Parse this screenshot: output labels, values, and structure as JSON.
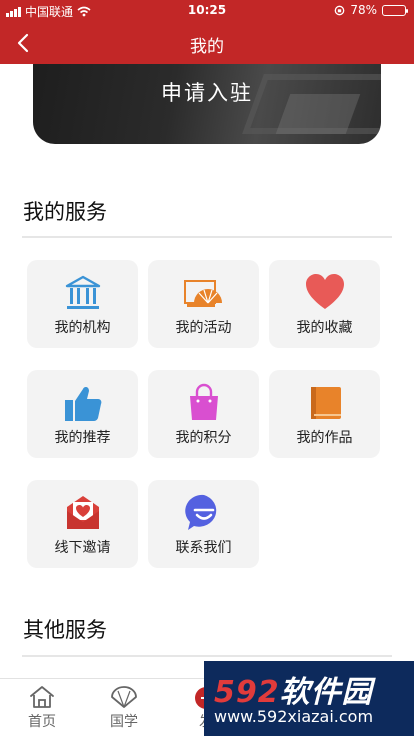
{
  "status_bar": {
    "carrier": "中国联通",
    "time": "10:25",
    "battery": "78%",
    "battery_level": 0.78
  },
  "nav": {
    "title": "我的",
    "back_icon": "chevron-left-icon"
  },
  "banner": {
    "label": "申请入驻"
  },
  "my_services": {
    "title": "我的服务",
    "items": [
      {
        "label": "我的机构",
        "icon": "institution-building-icon",
        "color": "#3a93d6"
      },
      {
        "label": "我的活动",
        "icon": "activity-fan-icon",
        "color": "#e8832a"
      },
      {
        "label": "我的收藏",
        "icon": "heart-icon",
        "color": "#e85a57"
      },
      {
        "label": "我的推荐",
        "icon": "thumbs-up-icon",
        "color": "#3a93d6"
      },
      {
        "label": "我的积分",
        "icon": "shopping-bag-icon",
        "color": "#d94fd0"
      },
      {
        "label": "我的作品",
        "icon": "book-icon",
        "color": "#e8832a"
      },
      {
        "label": "线下邀请",
        "icon": "envelope-heart-icon",
        "color": "#d9403a"
      },
      {
        "label": "联系我们",
        "icon": "chat-smile-icon",
        "color": "#5461e0"
      }
    ]
  },
  "other_services": {
    "title": "其他服务"
  },
  "tab_bar": [
    {
      "label": "首页",
      "icon": "home-icon"
    },
    {
      "label": "国学",
      "icon": "fan-icon"
    },
    {
      "label": "发",
      "icon": "publish-icon"
    }
  ],
  "watermark": {
    "brand_num": "592",
    "brand_text": "软件园",
    "url": "www.592xiazai.com"
  },
  "colors": {
    "primary": "#c22727",
    "tile_bg": "#f3f3f3"
  }
}
